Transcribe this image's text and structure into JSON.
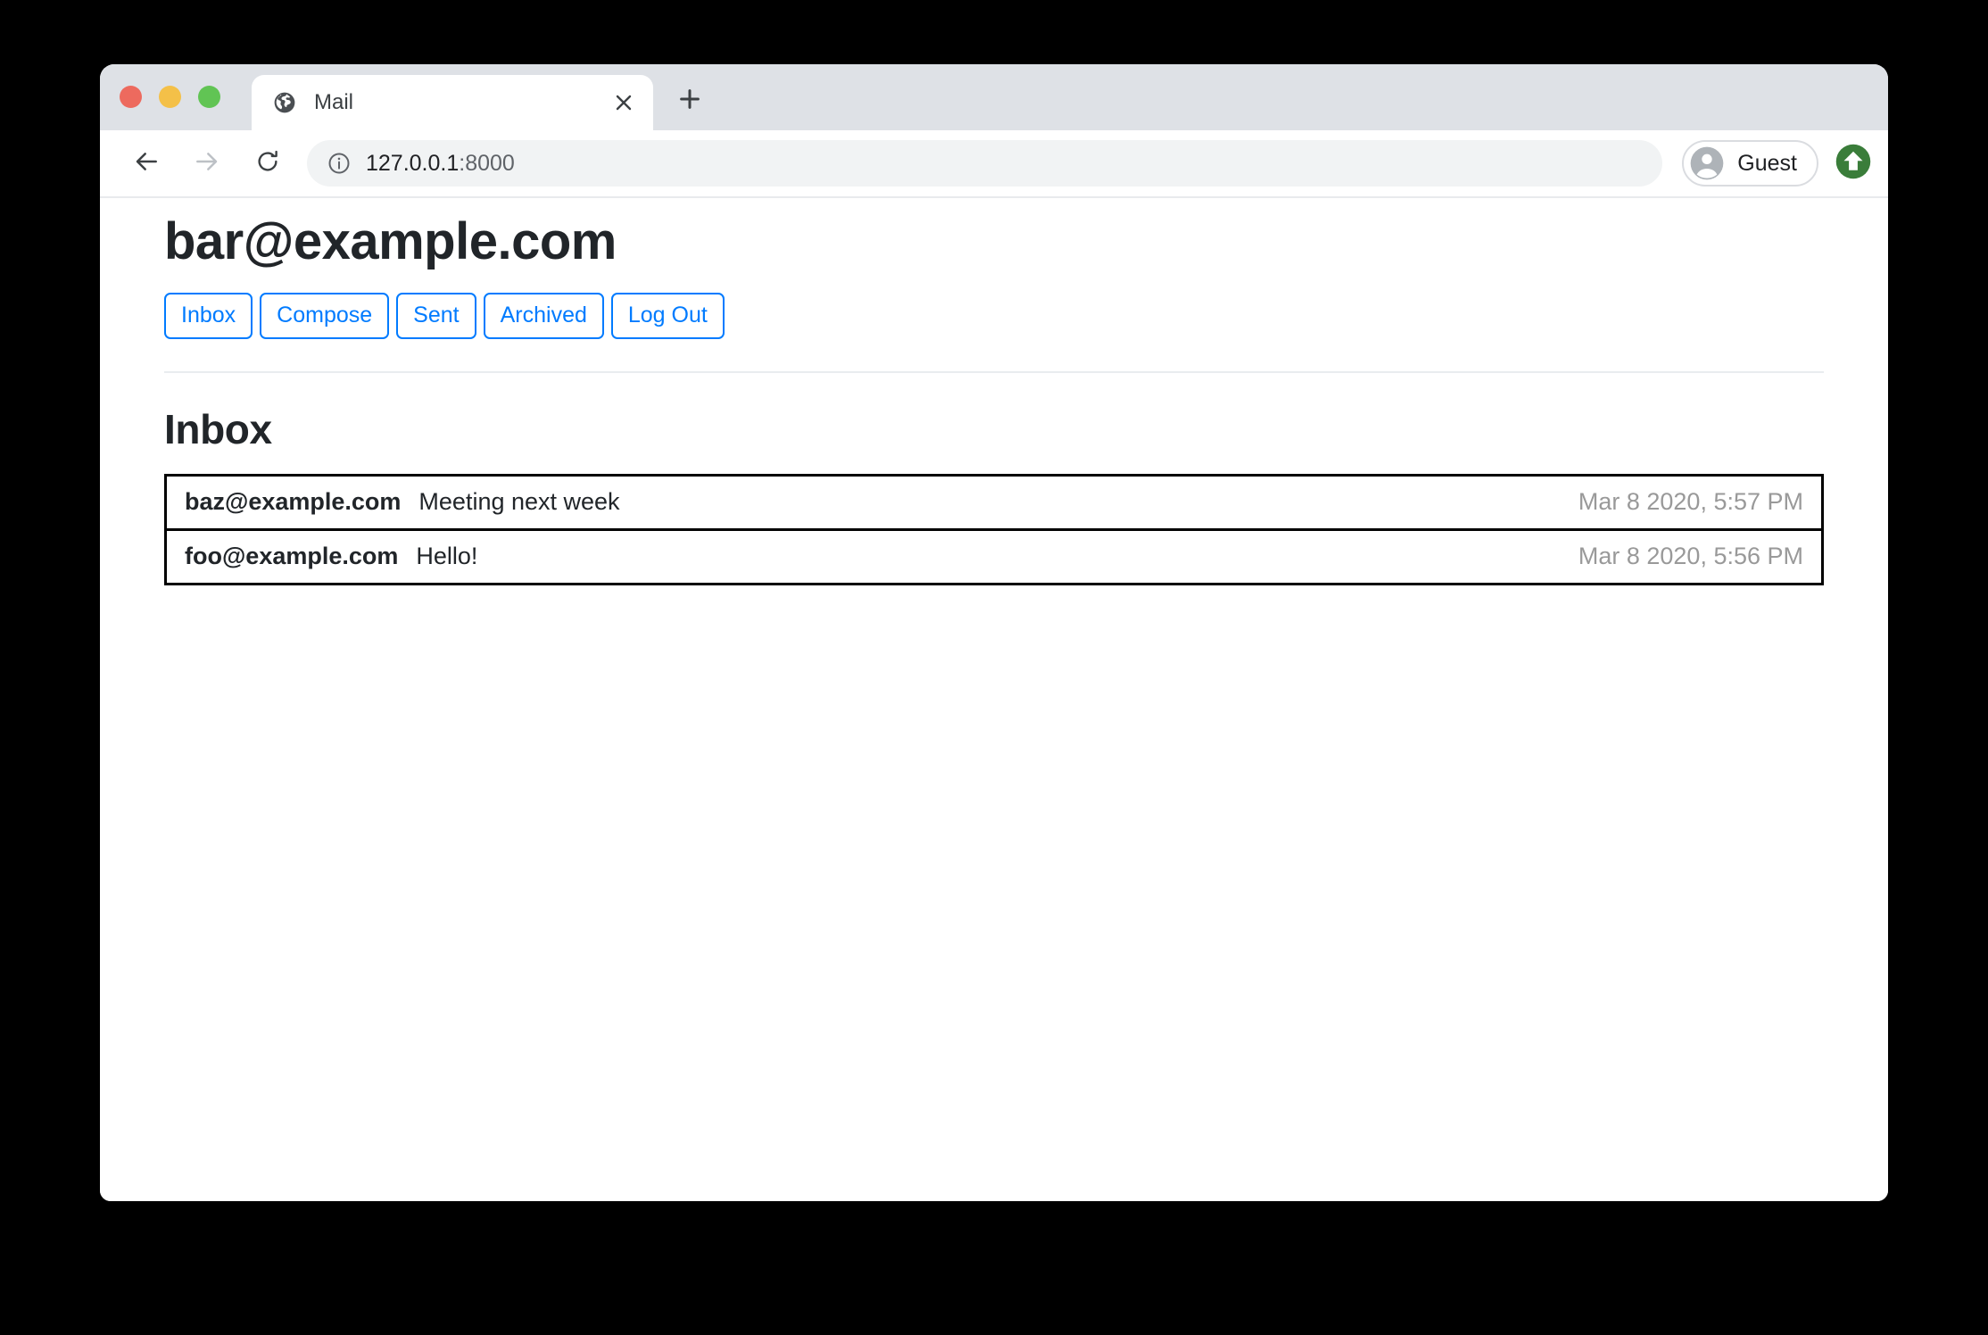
{
  "browser": {
    "tab": {
      "title": "Mail",
      "favicon": "globe-icon",
      "close_icon": "close-icon"
    },
    "new_tab_icon": "plus-icon",
    "traffic_lights": {
      "close": "#ed6a5e",
      "minimize": "#f4c048",
      "maximize": "#61c454"
    },
    "toolbar": {
      "back_icon": "back-arrow-icon",
      "forward_icon": "forward-arrow-icon",
      "reload_icon": "reload-icon",
      "omnibox": {
        "info_icon": "info-circle-icon",
        "url_host": "127.0.0.1",
        "url_port": ":8000",
        "full_url": "127.0.0.1:8000"
      },
      "profile": {
        "avatar_icon": "account-circle-icon",
        "label": "Guest"
      },
      "update_badge": {
        "icon": "arrow-up-icon",
        "color": "#3a7d3a"
      }
    }
  },
  "page": {
    "account_email": "bar@example.com",
    "nav_buttons": [
      {
        "label": "Inbox"
      },
      {
        "label": "Compose"
      },
      {
        "label": "Sent"
      },
      {
        "label": "Archived"
      },
      {
        "label": "Log Out"
      }
    ],
    "accent_color": "#007bff",
    "mailbox_heading": "Inbox",
    "emails": [
      {
        "sender": "baz@example.com",
        "subject": "Meeting next week",
        "timestamp": "Mar 8 2020, 5:57 PM"
      },
      {
        "sender": "foo@example.com",
        "subject": "Hello!",
        "timestamp": "Mar 8 2020, 5:56 PM"
      }
    ]
  }
}
